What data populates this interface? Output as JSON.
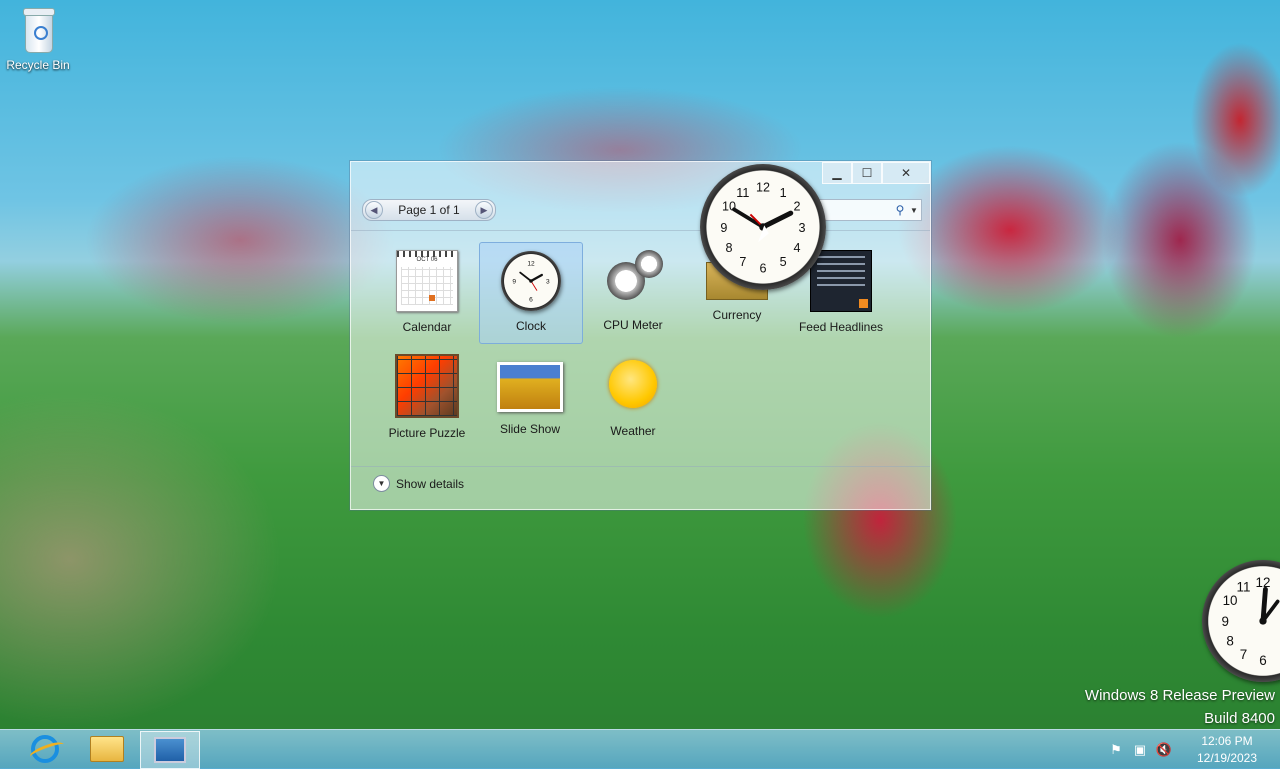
{
  "desktop": {
    "recycle_bin": "Recycle Bin",
    "watermark_line1": "Windows 8 Release Preview",
    "watermark_line2": "Build 8400"
  },
  "gallery": {
    "pager": "Page 1 of 1",
    "show_details": "Show details",
    "gadgets": [
      {
        "label": "Calendar",
        "icon": "calendar-icon"
      },
      {
        "label": "Clock",
        "icon": "clock-icon"
      },
      {
        "label": "CPU Meter",
        "icon": "cpu-meter-icon"
      },
      {
        "label": "Currency",
        "icon": "currency-icon"
      },
      {
        "label": "Feed Headlines",
        "icon": "feed-headlines-icon"
      },
      {
        "label": "Picture Puzzle",
        "icon": "picture-puzzle-icon"
      },
      {
        "label": "Slide Show",
        "icon": "slide-show-icon"
      },
      {
        "label": "Weather",
        "icon": "weather-icon"
      }
    ],
    "calendar_month": "OCT 06"
  },
  "taskbar": {
    "time": "12:06 PM",
    "date": "12/19/2023",
    "apps": [
      "internet-explorer-icon",
      "file-explorer-icon",
      "desktop-gadgets-icon"
    ]
  },
  "colors": {
    "accent": "#2a5ea8",
    "taskbar": "#5aaacd"
  }
}
